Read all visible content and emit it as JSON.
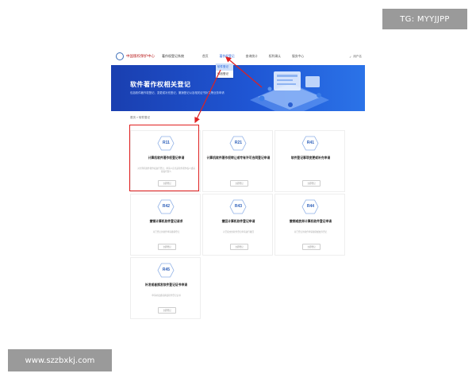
{
  "watermarks": {
    "top_right": "TG: MYYJJPP",
    "bottom_left": "www.szzbxkj.com"
  },
  "header": {
    "logo_text": "中国版权保护中心",
    "system_name": "著作权登记系统",
    "nav": [
      "首页",
      "著作权登记",
      "查询统计",
      "权利确认",
      "服务中心"
    ],
    "active_nav_index": 1,
    "user": "用户名"
  },
  "dropdown": {
    "items": [
      "软件登记",
      "作品登记"
    ],
    "highlight_index": 0
  },
  "banner": {
    "title": "软件著作权相关登记",
    "subtitle": "包括软件著作权登记、变更或补充登记、撤销登记以及相关证书补发等业务申请"
  },
  "breadcrumb": "首页 > 软件登记",
  "cards": [
    {
      "code": "R11",
      "title": "计算机软件著作权登记申请",
      "desc": "对计算机软件著作权进行登记，申请人应当是软件著作权人或其授权代理人",
      "button": "立即登记"
    },
    {
      "code": "R21",
      "title": "计算机软件著作权转让或专有许可合同登记申请",
      "desc": "",
      "button": "立即登记"
    },
    {
      "code": "R41",
      "title": "软件登记事项变更或补充申请",
      "desc": "",
      "button": "立即登记"
    },
    {
      "code": "R42",
      "title": "撤销计算机软件登记请求",
      "desc": "对已登记的软件申请撤销登记",
      "button": "立即登记"
    },
    {
      "code": "R43",
      "title": "撤回计算机软件登记申请",
      "desc": "对已提交的软件登记申请进行撤回",
      "button": "立即登记"
    },
    {
      "code": "R44",
      "title": "撤销或放弃计算机软件登记申请",
      "desc": "对已登记的软件申请撤销或放弃登记",
      "button": "立即登记"
    },
    {
      "code": "R45",
      "title": "补发或者换发软件登记证书申请",
      "desc": "申请补发或者换发软件登记证书",
      "button": "立即登记"
    }
  ],
  "colors": {
    "brand_blue": "#1f56d4",
    "highlight_red": "#e02020",
    "code_blue": "#2a5db8"
  }
}
